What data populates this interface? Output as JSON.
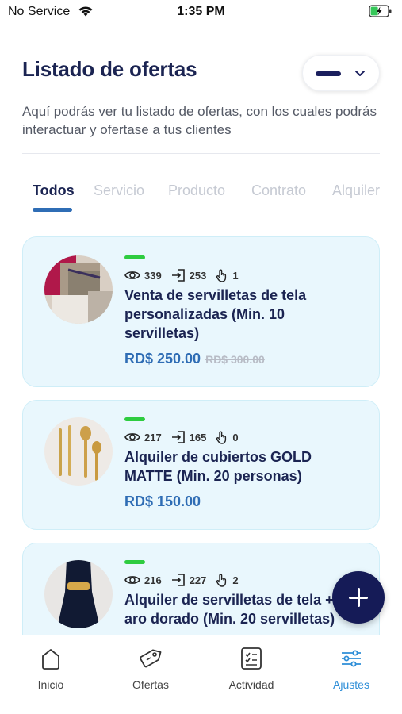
{
  "status_bar": {
    "carrier": "No Service",
    "time": "1:35 PM"
  },
  "header": {
    "title": "Listado de ofertas",
    "subtitle": "Aquí podrás ver tu listado de ofertas, con los cuales podrás interactuar y ofertase a tus clientes"
  },
  "tabs": [
    {
      "label": "Todos",
      "active": true
    },
    {
      "label": "Servicio",
      "active": false
    },
    {
      "label": "Producto",
      "active": false
    },
    {
      "label": "Contrato",
      "active": false
    },
    {
      "label": "Alquiler",
      "active": false
    }
  ],
  "offers": [
    {
      "views": "339",
      "entries": "253",
      "taps": "1",
      "title": "Venta de servilletas de tela personalizadas (Min. 10 servilletas)",
      "price": "RD$ 250.00",
      "old_price": "RD$ 300.00"
    },
    {
      "views": "217",
      "entries": "165",
      "taps": "0",
      "title": "Alquiler de cubiertos GOLD MATTE (Min. 20 personas)",
      "price": "RD$ 150.00",
      "old_price": ""
    },
    {
      "views": "216",
      "entries": "227",
      "taps": "2",
      "title": "Alquiler de servilletas de tela + aro dorado (Min. 20 servilletas)",
      "price": "",
      "old_price": ""
    }
  ],
  "bottom_nav": [
    {
      "label": "Inicio",
      "icon": "home-icon",
      "active": false
    },
    {
      "label": "Ofertas",
      "icon": "tag-icon",
      "active": false
    },
    {
      "label": "Actividad",
      "icon": "checklist-icon",
      "active": false
    },
    {
      "label": "Ajustes",
      "icon": "sliders-icon",
      "active": true
    }
  ],
  "colors": {
    "primary_dark": "#1b2452",
    "accent_blue": "#2f6db5",
    "card_bg": "#e9f7fd",
    "status_green": "#2ecc40",
    "fab": "#151b57",
    "nav_active": "#2f8fd8"
  }
}
